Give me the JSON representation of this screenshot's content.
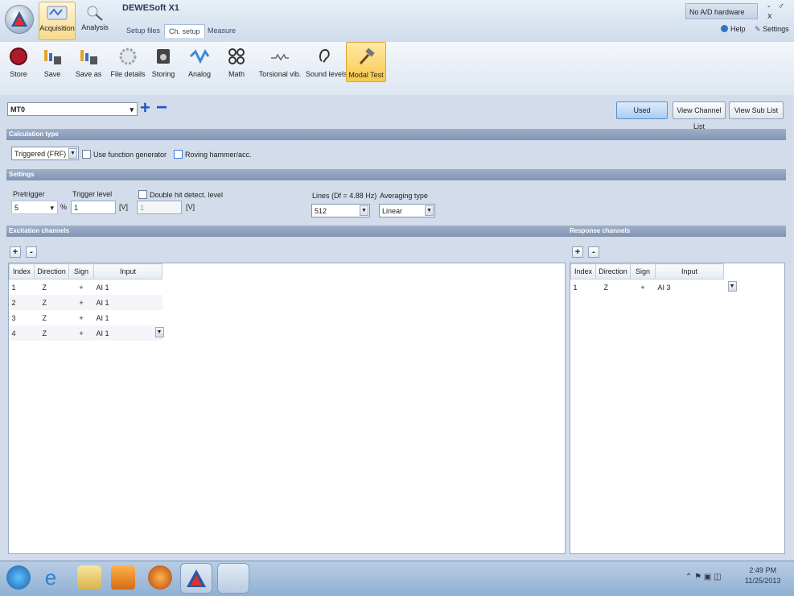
{
  "window": {
    "title": "DEWESoft X1",
    "hw_status": "No A/D hardware",
    "controls": "- ♂ x"
  },
  "modes": [
    {
      "label": "Acquisition"
    },
    {
      "label": "Analysis"
    }
  ],
  "nav_tabs": [
    {
      "label": "Setup files"
    },
    {
      "label": "Ch. setup"
    },
    {
      "label": "Measure"
    }
  ],
  "header_links": {
    "help": "Help",
    "settings": "Settings"
  },
  "toolbar": {
    "store": "Store",
    "save": "Save",
    "save_as": "Save as",
    "file_details": "File details",
    "storing": "Storing",
    "analog": "Analog",
    "math": "Math",
    "torsional": "Torsional vib.",
    "sound": "Sound levels",
    "modal": "Modal Test"
  },
  "module": {
    "selected": "MT0",
    "add": "+",
    "remove": "−"
  },
  "right_buttons": {
    "used": "Used",
    "view_channel_list": "View Channel List",
    "view_sub_list": "View Sub List"
  },
  "calc": {
    "header": "Calculation type",
    "type_value": "Triggered (FRF)",
    "use_function_generator": "Use function generator",
    "roving": "Roving hammer/acc."
  },
  "settings": {
    "header": "Settings",
    "pretrigger_label": "Pretrigger",
    "pretrigger_value": "5",
    "pretrigger_unit": "%",
    "trigger_level_label": "Trigger level",
    "trigger_level_value": "1",
    "trigger_level_unit": "[V]",
    "double_hit_label": "Double hit detect. level",
    "double_hit_value": "1",
    "double_hit_unit": "[V]",
    "lines_label": "Lines (Df = 4.88 Hz)",
    "lines_value": "512",
    "averaging_label": "Averaging type",
    "averaging_value": "Linear"
  },
  "excitation": {
    "header": "Excitation channels",
    "add": "+",
    "remove": "-",
    "columns": [
      "Index",
      "Direction",
      "Sign",
      "Input"
    ],
    "rows": [
      {
        "index": "1",
        "direction": "Z",
        "sign": "+",
        "input": "AI 1"
      },
      {
        "index": "2",
        "direction": "Z",
        "sign": "+",
        "input": "AI 1"
      },
      {
        "index": "3",
        "direction": "Z",
        "sign": "+",
        "input": "AI 1"
      },
      {
        "index": "4",
        "direction": "Z",
        "sign": "+",
        "input": "AI 1"
      }
    ]
  },
  "response": {
    "header": "Response channels",
    "add": "+",
    "remove": "-",
    "columns": [
      "Index",
      "Direction",
      "Sign",
      "Input"
    ],
    "rows": [
      {
        "index": "1",
        "direction": "Z",
        "sign": "+",
        "input": "AI 3"
      }
    ]
  },
  "taskbar": {
    "time": "2:49 PM",
    "date": "11/25/2013"
  },
  "colors": {
    "accent": "#f9c94a",
    "section": "#8396b5",
    "used": "#a9cdf2"
  }
}
